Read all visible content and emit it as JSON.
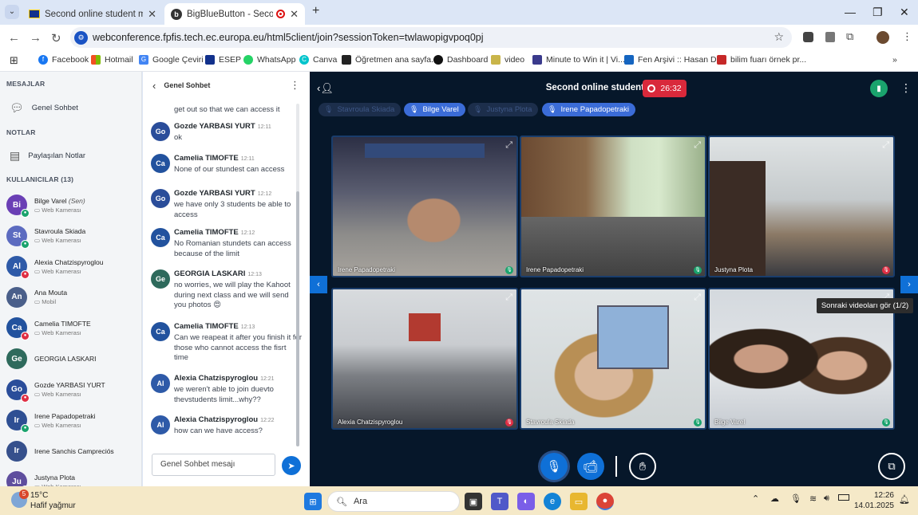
{
  "browser": {
    "tabs": [
      {
        "title": "Second online student meeting"
      },
      {
        "title": "BigBlueButton - Second onl"
      }
    ],
    "url": "webconference.fpfis.tech.ec.europa.eu/html5client/join?sessionToken=twlawopigvpoq0pj",
    "bookmarks": [
      "Facebook",
      "Hotmail",
      "Google Çeviri",
      "ESEP",
      "WhatsApp",
      "Canva",
      "Öğretmen ana sayfa...",
      "Dashboard",
      "video",
      "Minute to Win it | Vi...",
      "Fen Arşivi :: Hasan D...",
      "bilim fuarı örnek pr..."
    ],
    "bookmark_overflow": "»"
  },
  "left": {
    "messages_header": "MESAJLAR",
    "public_chat": "Genel Sohbet",
    "notes_header": "NOTLAR",
    "shared_notes": "Paylaşılan Notlar",
    "users_header": "KULLANICILAR (13)",
    "users": [
      {
        "initials": "Bi",
        "name": "Bilge Varel",
        "you": "(Sen)",
        "role": "Web Kamerası",
        "color": "#6a3fb5",
        "status": "g"
      },
      {
        "initials": "St",
        "name": "Stavroula Skiada",
        "role": "Web Kamerası",
        "color": "#5c6bc0",
        "status": "g"
      },
      {
        "initials": "Al",
        "name": "Alexia Chatzispyroglou",
        "role": "Web Kamerası",
        "color": "#2e5aa8",
        "status": "r"
      },
      {
        "initials": "An",
        "name": "Ana Mouta",
        "role": "Mobil",
        "color": "#4a5f8a",
        "status": ""
      },
      {
        "initials": "Ca",
        "name": "Camelia TIMOFTE",
        "role": "Web Kamerası",
        "color": "#22529e",
        "status": "r"
      },
      {
        "initials": "Ge",
        "name": "GEORGIA LASKARI",
        "role": "",
        "color": "#2e6a5c",
        "status": ""
      },
      {
        "initials": "Go",
        "name": "Gozde YARBASI YURT",
        "role": "Web Kamerası",
        "color": "#2a4d9a",
        "status": "r"
      },
      {
        "initials": "Ir",
        "name": "Irene Papadopetraki",
        "role": "Web Kamerası",
        "color": "#2e4f93",
        "status": "g"
      },
      {
        "initials": "Ir",
        "name": "Irene Sanchis Campreciós",
        "role": "",
        "color": "#36508c",
        "status": ""
      },
      {
        "initials": "Ju",
        "name": "Justyna Plota",
        "role": "Web Kamerası",
        "color": "#5f4e9e",
        "status": "r"
      }
    ]
  },
  "chat": {
    "title": "Genel Sohbet",
    "top_fragment": "get out so that we can access it",
    "messages": [
      {
        "initials": "Go",
        "name": "Gozde YARBASI YURT",
        "time": "12:11",
        "text": "ok",
        "color": "#2a4d9a"
      },
      {
        "initials": "Ca",
        "name": "Camelia TIMOFTE",
        "time": "12:11",
        "text": "None of our stundest can access",
        "color": "#22529e"
      },
      {
        "initials": "Go",
        "name": "Gozde YARBASI YURT",
        "time": "12:12",
        "text": "we have only 3 students be able to access",
        "color": "#2a4d9a"
      },
      {
        "initials": "Ca",
        "name": "Camelia TIMOFTE",
        "time": "12:12",
        "text": "No Romanian stundets can access because of the limit",
        "color": "#22529e"
      },
      {
        "initials": "Ge",
        "name": "GEORGIA LASKARI",
        "time": "12:13",
        "text": "no worries, we will play the Kahoot during next class and we will send you photos 😍",
        "color": "#2e6a5c"
      },
      {
        "initials": "Ca",
        "name": "Camelia TIMOFTE",
        "time": "12:13",
        "text": "Can we reapeat it after you finish it for those who cannot access the fisrt time",
        "color": "#22529e"
      },
      {
        "initials": "Al",
        "name": "Alexia Chatzispyroglou",
        "time": "12:21",
        "text": "we weren't able to join duevto thevstudents limit...why??",
        "color": "#2e5aa8"
      },
      {
        "initials": "Al",
        "name": "Alexia Chatzispyroglou",
        "time": "12:22",
        "text": "how can we have access?",
        "color": "#2e5aa8"
      }
    ],
    "input_placeholder": "Genel Sohbet mesajı"
  },
  "meeting": {
    "title": "Second online student meeting",
    "recording_time": "26:32",
    "talkers": [
      {
        "name": "Stavroula Skiada",
        "active": false
      },
      {
        "name": "Bilge Varel",
        "active": true
      },
      {
        "name": "Justyna Plota",
        "active": false
      },
      {
        "name": "Irene Papadopetraki",
        "active": true
      }
    ],
    "tiles": [
      {
        "name": "Irene Papadopetraki",
        "mic": "g"
      },
      {
        "name": "Irene Papadopetraki",
        "mic": "g"
      },
      {
        "name": "Justyna Plota",
        "mic": "r"
      },
      {
        "name": "Alexia Chatzispyroglou",
        "mic": "r"
      },
      {
        "name": "Stavroula Skiada",
        "mic": "g"
      },
      {
        "name": "Bilge Varel",
        "mic": "g"
      }
    ],
    "next_tooltip": "Sonraki videoları gör (1/2)"
  },
  "taskbar": {
    "temperature": "15°C",
    "weather": "Hafif yağmur",
    "weather_badge": "5",
    "search": "Ara",
    "time": "12:26",
    "date": "14.01.2025"
  }
}
